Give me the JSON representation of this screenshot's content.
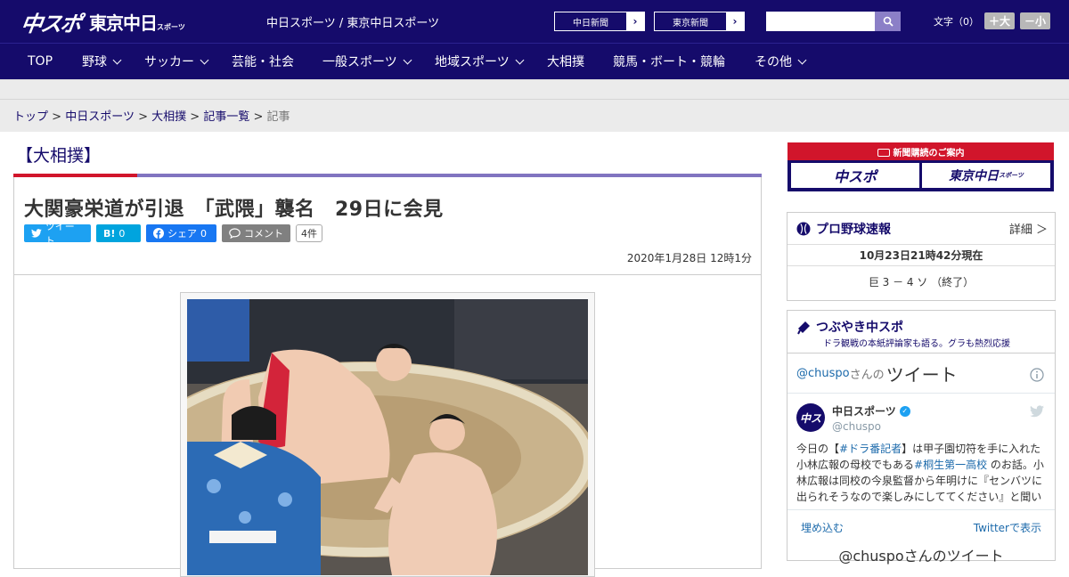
{
  "header": {
    "logo_chuspo": "中スポ",
    "logo_tokyo": "東京中日",
    "logo_tokyo_sub": "スポーツ",
    "site_links": "中日スポーツ / 東京中日スポーツ",
    "np_chunichi": "中日新聞",
    "np_tokyo": "東京新聞",
    "search_placeholder": "",
    "font_label": "文字（0）",
    "font_plus": "＋大",
    "font_minus": "－小"
  },
  "nav": [
    {
      "label": "TOP",
      "dropdown": false
    },
    {
      "label": "野球",
      "dropdown": true
    },
    {
      "label": "サッカー",
      "dropdown": true
    },
    {
      "label": "芸能・社会",
      "dropdown": false
    },
    {
      "label": "一般スポーツ",
      "dropdown": true
    },
    {
      "label": "地域スポーツ",
      "dropdown": true
    },
    {
      "label": "大相撲",
      "dropdown": false
    },
    {
      "label": "競馬・ボート・競輪",
      "dropdown": false
    },
    {
      "label": "その他",
      "dropdown": true
    }
  ],
  "breadcrumb": {
    "items": [
      "トップ",
      "中日スポーツ",
      "大相撲",
      "記事一覧"
    ],
    "current": "記事",
    "sep": ">"
  },
  "article": {
    "category": "【大相撲】",
    "headline": "大関豪栄道が引退　「武隈」襲名　29日に会見",
    "tweet_label": "ツイート",
    "hatena_label": "B!",
    "hatena_count": "0",
    "share_label": "シェア",
    "share_count": "0",
    "comment_label": "コメント",
    "comment_count": "4件",
    "date": "2020年1月28日 12時1分"
  },
  "sidebar": {
    "ad_title": "新聞購読のご案内",
    "ad_left": "中スポ",
    "ad_right": "東京中日",
    "ad_right_sub": "スポーツ",
    "baseball_title": "プロ野球速報",
    "baseball_more": "詳細 ＞",
    "baseball_time": "10月23日21時42分現在",
    "baseball_score": "巨 3 － 4 ソ （終了）",
    "tsubuyaki_title": "つぶやき中スポ",
    "tsubuyaki_sub": "ドラ観戦の本紙評論家も語る。グラも熱烈応援",
    "tweet_handle_prefix": "@chuspo",
    "tweet_handle_suffix": "さんの",
    "tweet_heading": "ツイート",
    "tweet_user": "中日スポーツ",
    "tweet_user_handle": "@chuspo",
    "tweet_text_1": "今日の【",
    "tweet_hashtag_1": "#ドラ番記者",
    "tweet_text_2": "】は甲子園切符を手に入れた小林広報の母校でもある",
    "tweet_hashtag_2": "#桐生第一高校",
    "tweet_text_3": " のお話。小林広報は同校の今泉監督から年明けに『センバツに出られそうなので楽しみにしててください』と聞い",
    "tweet_embed": "埋め込む",
    "tweet_view": "Twitterで表示",
    "tweet_footer": "@chuspoさんのツイート"
  },
  "colors": {
    "brand_navy": "#150b6b",
    "accent_red": "#d1152b",
    "accent_purple": "#8174c0",
    "twitter_blue": "#1da1f2",
    "hatena_blue": "#00a4de",
    "facebook_blue": "#1877f2"
  }
}
